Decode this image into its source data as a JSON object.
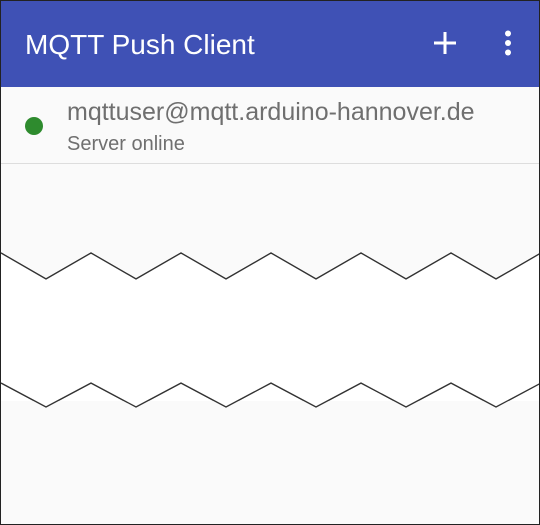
{
  "app_bar": {
    "title": "MQTT Push Client",
    "add_icon": "plus-icon",
    "more_icon": "more-vert-icon"
  },
  "connection": {
    "account": "mqttuser@mqtt.arduino-hannover.de",
    "status": "Server online",
    "status_icon": "status-dot-icon"
  },
  "colors": {
    "app_bar": "#3f51b5",
    "status_online": "#2e8b2e"
  }
}
